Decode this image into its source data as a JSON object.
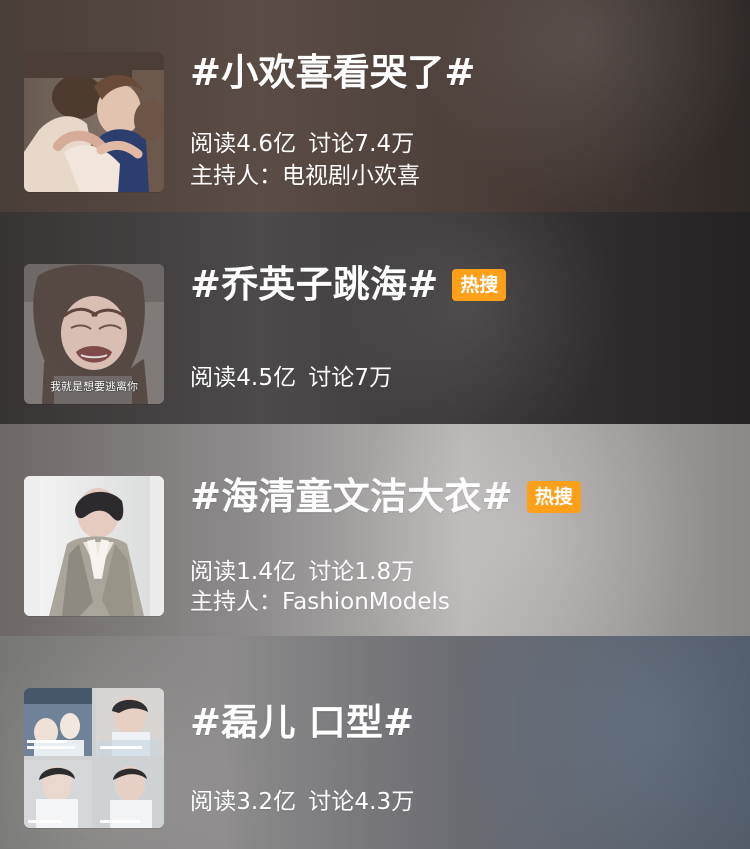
{
  "topics": [
    {
      "thumbnail_icon": "drama-hug-thumbnail",
      "title": "#小欢喜看哭了#",
      "reads_label": "阅读4.6亿",
      "discussions_label": "讨论7.4万",
      "host_label": "主持人：电视剧小欢喜",
      "hot_badge": ""
    },
    {
      "thumbnail_icon": "crying-face-thumbnail",
      "title": "#乔英子跳海#",
      "reads_label": "阅读4.5亿",
      "discussions_label": "讨论7万",
      "host_label": "",
      "hot_badge": "热搜",
      "thumbnail_caption": "我就是想要逃离你"
    },
    {
      "thumbnail_icon": "coat-portrait-thumbnail",
      "title": "#海清童文洁大衣#",
      "reads_label": "阅读1.4亿",
      "discussions_label": "讨论1.8万",
      "host_label": "主持人：FashionModels",
      "hot_badge": "热搜"
    },
    {
      "thumbnail_icon": "classroom-collage-thumbnail",
      "title": "#磊儿 口型#",
      "reads_label": "阅读3.2亿",
      "discussions_label": "讨论4.3万",
      "host_label": "",
      "hot_badge": ""
    }
  ],
  "colors": {
    "text": "#ffffff",
    "hot_badge": "#ff9f1a"
  }
}
